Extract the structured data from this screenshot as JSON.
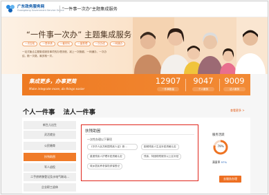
{
  "header": {
    "site_name": "广东政务服务网",
    "site_sub": "Guangdong Government Service Online",
    "title": "\"一件事一次办\"主题集成服务"
  },
  "hero": {
    "title": "“一件事一次办” 主题集成服务",
    "pills": [
      "一次告知",
      "一表申请",
      "一套材料",
      "一窗受理",
      "一次办成",
      "一网通办"
    ],
    "description": "一站式聚合主题集成服务事项的办理流程，减上一次跑腿，一网通办，一次办结，跑一次路，最多跑一次。"
  },
  "banner": {
    "title": "集成更多，办事更简",
    "subtitle": "Make integrate more, do things easier",
    "stats": [
      {
        "value": "12907",
        "label": "一件事数量"
      },
      {
        "value": "9047",
        "label": "个人服务"
      },
      {
        "value": "9009",
        "label": "法人服务"
      }
    ]
  },
  "tabs": [
    {
      "label": "个人一件事",
      "active": true
    },
    {
      "label": "法人一件事",
      "active": false
    }
  ],
  "more_link": "查看更多 >",
  "side_menu": [
    {
      "label": "新生儿出生",
      "active": false
    },
    {
      "label": "灵活就业",
      "active": false
    },
    {
      "label": "公民婚育",
      "active": false
    },
    {
      "label": "扶残助困",
      "active": true
    },
    {
      "label": "军人退役",
      "active": false
    },
    {
      "label": "二手房转移登记及水电气联动...",
      "active": false
    },
    {
      "label": "企业职工退休",
      "active": false
    }
  ],
  "focus_box": {
    "heading": "扶残助困",
    "subtitle": "一次性办理以下事项",
    "items": [
      "《中华人民共和国残疾人证》新...",
      "困难残疾人生活补贴资格认定",
      "重度残疾人护理补贴资格认定",
      "残疾、特困助残服务以上区补贴",
      "城乡居民养老保险参保登记"
    ]
  },
  "service": {
    "title": "服务活跃",
    "gauge_value": "79%",
    "gauge_fraction": 0.79,
    "rate_label": "满意率",
    "rate_value": "97%",
    "button": "去服务办理"
  },
  "colors": {
    "accent": "#f07b28",
    "highlight_border": "#e0241a",
    "header_blue": "#0a57a8"
  }
}
